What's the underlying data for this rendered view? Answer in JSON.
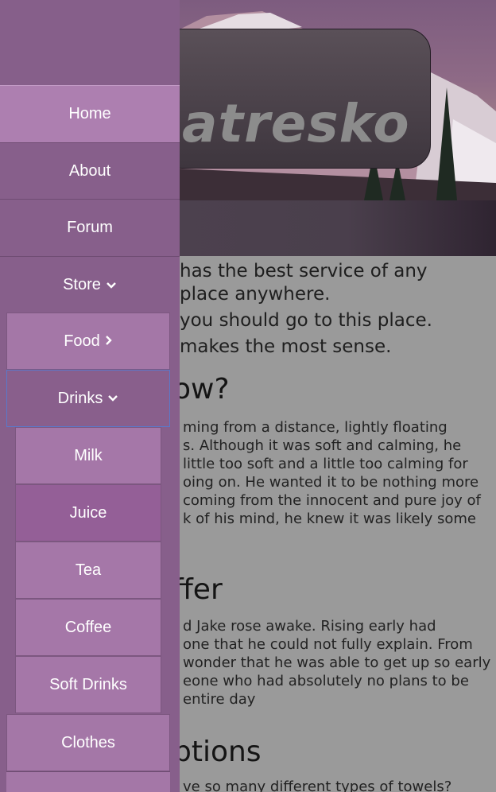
{
  "brand": {
    "text": "atresko"
  },
  "content": {
    "lead_lines": [
      "has the best service of any",
      "place anywhere.",
      "you should go to this place.",
      "makes the most sense."
    ],
    "section1": {
      "heading": "ow?",
      "lines": [
        "ming from a distance, lightly floating",
        "s. Although it was soft and calming, he",
        "little too soft and a little too calming for",
        "oing on. He wanted it to be nothing more",
        "coming from the innocent and pure joy of",
        "k of his mind, he knew it was likely some"
      ]
    },
    "section2": {
      "heading": "ffer",
      "lines": [
        "d Jake rose awake. Rising early had",
        "one that he could not fully explain. From",
        "wonder that he was able to get up so early",
        "eone who had absolutely no plans to be",
        "entire day"
      ]
    },
    "section3": {
      "heading": "ptions",
      "lines": [
        "ve so many different types of towels?"
      ]
    }
  },
  "nav": {
    "home": "Home",
    "about": "About",
    "forum": "Forum",
    "store": "Store",
    "food": "Food",
    "drinks": "Drinks",
    "milk": "Milk",
    "juice": "Juice",
    "tea": "Tea",
    "coffee": "Coffee",
    "soft_drinks": "Soft Drinks",
    "clothes": "Clothes"
  },
  "icons": {
    "chevron_down": "chevron-down-icon",
    "chevron_right": "chevron-right-icon"
  },
  "colors": {
    "sidebar": "#875f8b",
    "active": "#ad7fb0",
    "submenu": "#a477a7",
    "focus_border": "#5b78c9"
  }
}
